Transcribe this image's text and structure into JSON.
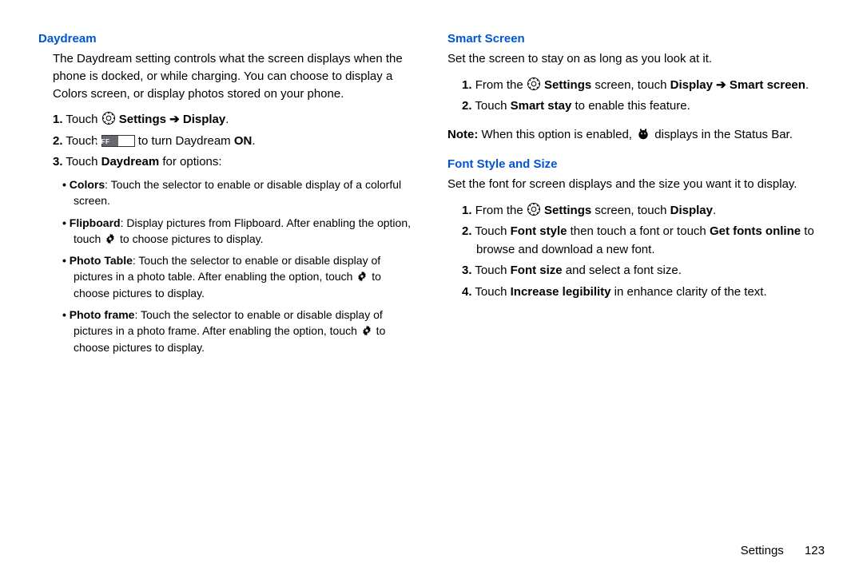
{
  "left": {
    "title": "Daydream",
    "intro": "The Daydream setting controls what the screen displays when the phone is docked, or while charging. You can choose to display a Colors screen, or display photos stored on your phone.",
    "steps": {
      "s1_a": "Touch ",
      "s1_b": " Settings ",
      "s1_arrow": "➔",
      "s1_c": " Display",
      "s1_d": ".",
      "s2_a": "Touch ",
      "s2_off": "OFF",
      "s2_b": " to turn Daydream ",
      "s2_on": "ON",
      "s2_c": ".",
      "s3_a": "Touch ",
      "s3_b": "Daydream",
      "s3_c": " for options:"
    },
    "bullets": {
      "b1_lbl": "Colors",
      "b1_txt": ": Touch the selector to enable or disable display of a colorful screen.",
      "b2_lbl": "Flipboard",
      "b2_txt_a": ": Display pictures from Flipboard. After enabling the option, touch ",
      "b2_txt_b": " to choose pictures to display.",
      "b3_lbl": "Photo Table",
      "b3_txt_a": ": Touch the selector to enable or disable display of pictures in a photo table. After enabling the option, touch ",
      "b3_txt_b": " to choose pictures to display.",
      "b4_lbl": "Photo frame",
      "b4_txt_a": ": Touch the selector to enable or disable display of pictures in a photo frame. After enabling the option, touch ",
      "b4_txt_b": " to choose pictures to display."
    }
  },
  "right": {
    "smart": {
      "title": "Smart Screen",
      "intro": "Set the screen to stay on as long as you look at it.",
      "s1_a": "From the ",
      "s1_b": " Settings",
      "s1_c": " screen, touch ",
      "s1_d": "Display ",
      "s1_arrow": "➔",
      "s1_e": " Smart screen",
      "s1_f": ".",
      "s2_a": "Touch ",
      "s2_b": "Smart stay",
      "s2_c": " to enable this feature.",
      "note_lbl": "Note:",
      "note_a": " When this option is enabled, ",
      "note_b": " displays in the Status Bar."
    },
    "font": {
      "title": "Font Style and Size",
      "intro": "Set the font for screen displays and the size you want it to display.",
      "s1_a": "From the ",
      "s1_b": " Settings",
      "s1_c": " screen, touch ",
      "s1_d": "Display",
      "s1_e": ".",
      "s2_a": "Touch ",
      "s2_b": "Font style",
      "s2_c": " then touch a font or touch ",
      "s2_d": "Get fonts online",
      "s2_e": " to browse and download a new font.",
      "s3_a": "Touch ",
      "s3_b": "Font size",
      "s3_c": " and select a font size.",
      "s4_a": "Touch ",
      "s4_b": "Increase legibility",
      "s4_c": " in enhance clarity of the text."
    }
  },
  "footer": {
    "label": "Settings",
    "page": "123"
  }
}
